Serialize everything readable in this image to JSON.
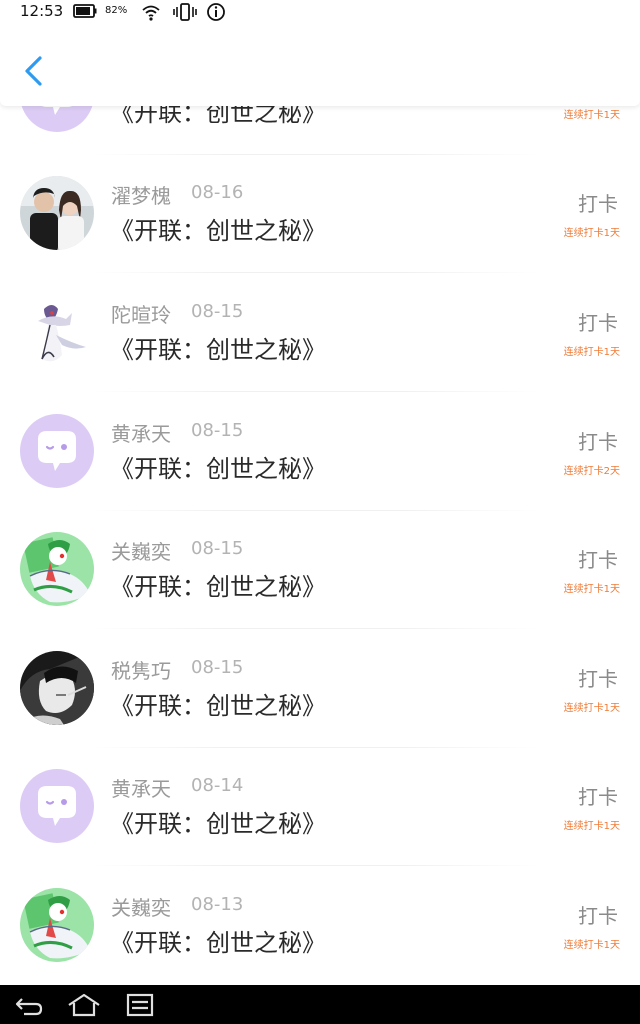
{
  "status_bar": {
    "time": "12:53",
    "battery_percent": "82%",
    "icons": [
      "battery-icon",
      "wifi-icon",
      "vibrate-icon",
      "info-icon"
    ]
  },
  "header": {
    "back_icon": "chevron-left-icon",
    "accent_color": "#2f9bf0"
  },
  "checkins": [
    {
      "name": "",
      "date": "",
      "book": "《开联：创世之秘》",
      "action": "",
      "streak": "连续打卡1天",
      "avatar": "chat-bubble"
    },
    {
      "name": "濯梦槐",
      "date": "08-16",
      "book": "《开联：创世之秘》",
      "action": "打卡",
      "streak": "连续打卡1天",
      "avatar": "couple-photo"
    },
    {
      "name": "陀暄玲",
      "date": "08-15",
      "book": "《开联：创世之秘》",
      "action": "打卡",
      "streak": "连续打卡1天",
      "avatar": "pokemon-gardevoir-dark"
    },
    {
      "name": "黄承天",
      "date": "08-15",
      "book": "《开联：创世之秘》",
      "action": "打卡",
      "streak": "连续打卡2天",
      "avatar": "chat-bubble"
    },
    {
      "name": "关巍奕",
      "date": "08-15",
      "book": "《开联：创世之秘》",
      "action": "打卡",
      "streak": "连续打卡1天",
      "avatar": "pokemon-gardevoir-green"
    },
    {
      "name": "税隽巧",
      "date": "08-15",
      "book": "《开联：创世之秘》",
      "action": "打卡",
      "streak": "连续打卡1天",
      "avatar": "bw-portrait"
    },
    {
      "name": "黄承天",
      "date": "08-14",
      "book": "《开联：创世之秘》",
      "action": "打卡",
      "streak": "连续打卡1天",
      "avatar": "chat-bubble"
    },
    {
      "name": "关巍奕",
      "date": "08-13",
      "book": "《开联：创世之秘》",
      "action": "打卡",
      "streak": "连续打卡1天",
      "avatar": "pokemon-gardevoir-green"
    }
  ],
  "nav_bar": {
    "icons": [
      "back-icon",
      "home-icon",
      "menu-icon"
    ]
  },
  "colors": {
    "streak": "#f07a36",
    "chat_bubble_bg": "#dcccf5",
    "chat_bubble_fg": "#b79be8"
  }
}
